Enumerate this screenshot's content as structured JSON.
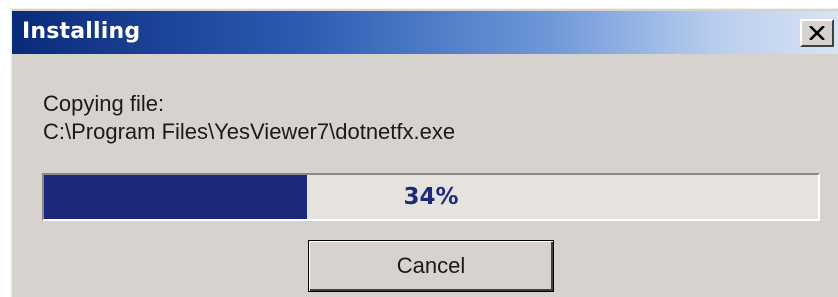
{
  "dialog": {
    "title": "Installing",
    "close_icon": "close-icon",
    "status_label": "Copying file:",
    "file_path": "C:\\Program Files\\YesViewer7\\dotnetfx.exe",
    "progress": {
      "percent": 34,
      "label": "34%"
    },
    "cancel_label": "Cancel"
  },
  "colors": {
    "progress_fill": "#1d2a7c",
    "progress_text": "#1d2a7c",
    "dialog_bg": "#d6d3ce",
    "titlebar_start": "#0a2a7a",
    "titlebar_end": "#d9e3f4"
  }
}
